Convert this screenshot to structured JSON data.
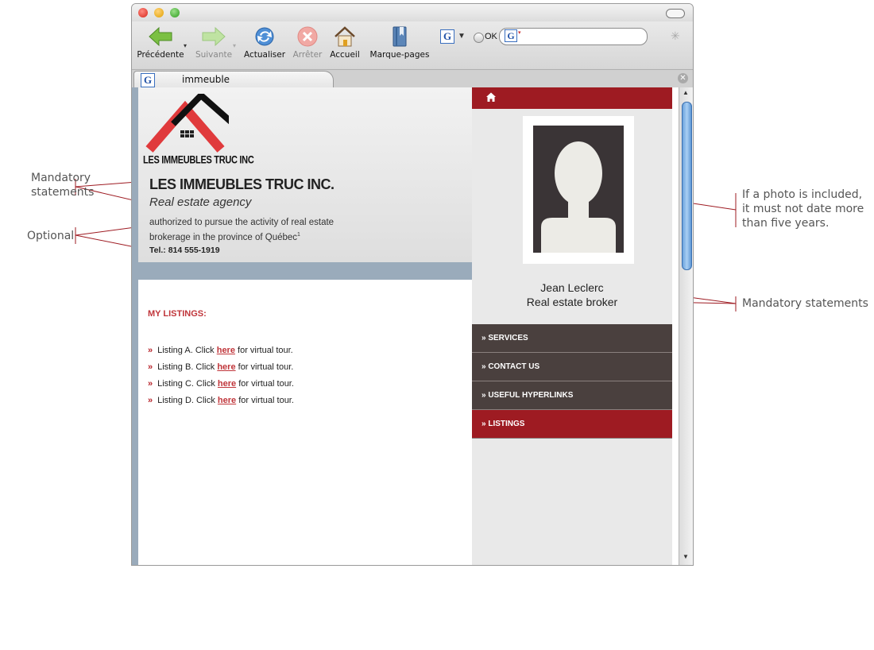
{
  "annotations": {
    "mandatory_left": [
      "Mandatory",
      "statements"
    ],
    "optional_left": "Optional",
    "photo_note": [
      "If a photo is included,",
      "it must not date more",
      "than five years."
    ],
    "mandatory_right": "Mandatory statements"
  },
  "toolbar": {
    "back": "Précédente",
    "forward": "Suivante",
    "reload": "Actualiser",
    "stop": "Arrêter",
    "home": "Accueil",
    "bookmarks": "Marque-pages",
    "ok": "OK"
  },
  "tab": {
    "label": "immeuble"
  },
  "site": {
    "logo_text": "LES IMMEUBLES TRUC INC",
    "company_name": "LES IMMEUBLES TRUC INC.",
    "agency_type": "Real estate agency",
    "authorization_line1": "authorized to pursue the activity of real estate",
    "authorization_line2": "brokerage in the province of Québec",
    "authorization_footnote": "1",
    "phone": "Tel.: 814 555-1919",
    "listings_title": "MY LISTINGS:",
    "listings": [
      {
        "prefix": "Listing A.  Click ",
        "link": "here",
        "suffix": " for virtual tour."
      },
      {
        "prefix": "Listing B.  Click ",
        "link": "here",
        "suffix": " for virtual tour."
      },
      {
        "prefix": "Listing C.  Click ",
        "link": "here",
        "suffix": " for virtual tour."
      },
      {
        "prefix": "Listing D.  Click ",
        "link": "here",
        "suffix": " for virtual tour."
      }
    ],
    "broker_name": "Jean Leclerc",
    "broker_title": "Real estate broker",
    "menu": [
      "» SERVICES",
      "» CONTACT US",
      "» USEFUL HYPERLINKS",
      "» LISTINGS"
    ]
  },
  "colors": {
    "accent_red": "#9e1b22",
    "menu_brown": "#4a403e",
    "annotation_line": "#9e1b22"
  }
}
